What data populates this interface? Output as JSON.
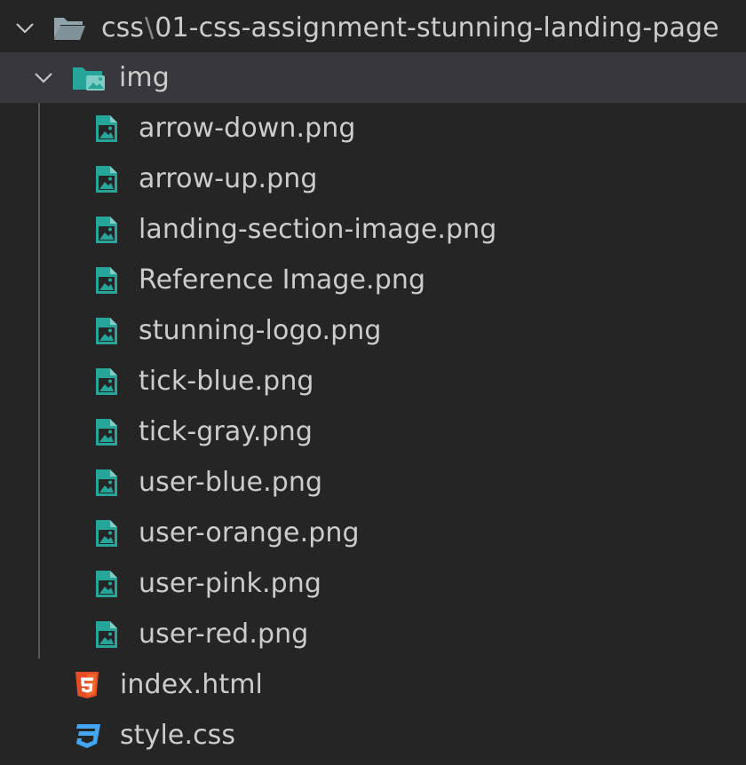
{
  "explorer": {
    "root": {
      "path_parts": [
        "css",
        "01-css-assignment-stunning-landing-page"
      ],
      "separator": "\\",
      "icon": "folder-open-icon",
      "expanded": true
    },
    "img_folder": {
      "label": "img",
      "icon": "folder-image-icon",
      "expanded": true,
      "selected": true,
      "files": [
        {
          "label": "arrow-down.png",
          "icon": "image-file-icon"
        },
        {
          "label": "arrow-up.png",
          "icon": "image-file-icon"
        },
        {
          "label": "landing-section-image.png",
          "icon": "image-file-icon"
        },
        {
          "label": "Reference Image.png",
          "icon": "image-file-icon"
        },
        {
          "label": "stunning-logo.png",
          "icon": "image-file-icon"
        },
        {
          "label": "tick-blue.png",
          "icon": "image-file-icon"
        },
        {
          "label": "tick-gray.png",
          "icon": "image-file-icon"
        },
        {
          "label": "user-blue.png",
          "icon": "image-file-icon"
        },
        {
          "label": "user-orange.png",
          "icon": "image-file-icon"
        },
        {
          "label": "user-pink.png",
          "icon": "image-file-icon"
        },
        {
          "label": "user-red.png",
          "icon": "image-file-icon"
        }
      ]
    },
    "root_files": [
      {
        "label": "index.html",
        "icon": "html5-icon"
      },
      {
        "label": "style.css",
        "icon": "css3-icon"
      }
    ]
  },
  "colors": {
    "background": "#252526",
    "selected_row": "#37373d",
    "text": "#cccccc",
    "image_icon": "#26a69a",
    "html_icon": "#e44d26",
    "css_icon": "#42a5f5",
    "folder_root": "#90a4ae"
  }
}
